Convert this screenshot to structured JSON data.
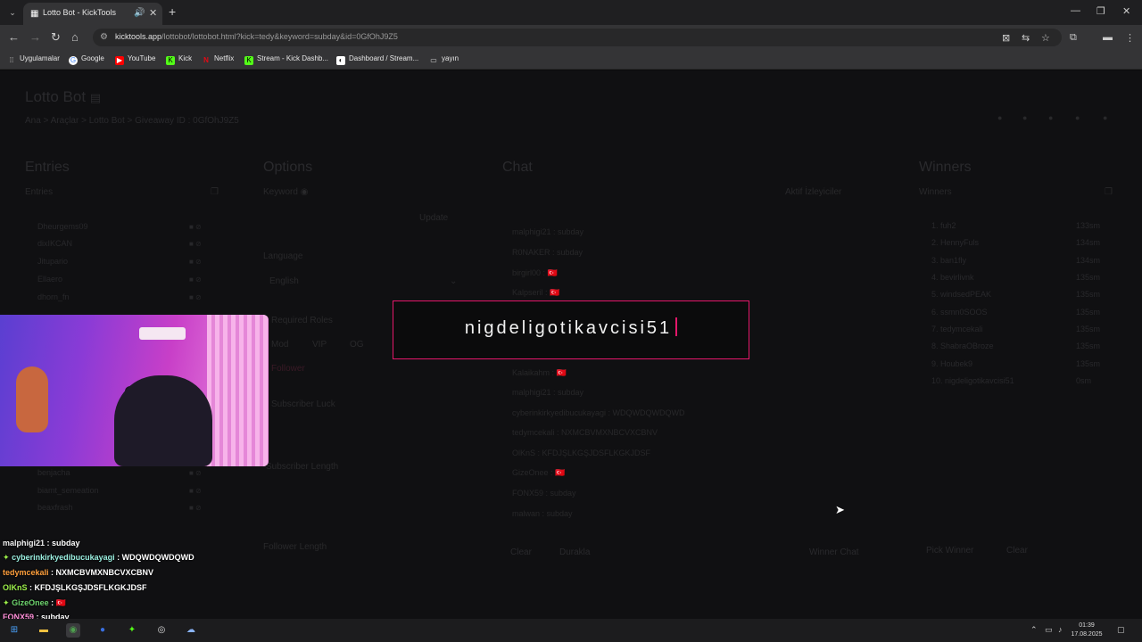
{
  "browser": {
    "tab_title": "Lotto Bot - KickTools",
    "url_host": "kicktools.app",
    "url_path": "/lottobot/lottobot.html?kick=tedy&keyword=subday&id=0GfOhJ9Z5",
    "bookmarks": [
      "Uygulamalar",
      "Google",
      "YouTube",
      "Kick",
      "Netflix",
      "Stream - Kick Dashb...",
      "Dashboard / Stream...",
      "yayın"
    ]
  },
  "page": {
    "title": "Lotto Bot",
    "breadcrumb": "Ana  >  Araçlar  >  Lotto Bot  >  Giveaway ID : 0GfOhJ9Z5",
    "columns": {
      "entries": "Entries",
      "options": "Options",
      "chat": "Chat",
      "winners": "Winners"
    },
    "entries_sub": "Entries",
    "entries": [
      "Dheurgems09",
      "dixIKCAN",
      "Jitupario",
      "Ellaero",
      "dhorn_fn",
      "benjacha",
      "biamt_semeation",
      "beaxfrash"
    ],
    "options": {
      "keyword_label": "Keyword",
      "update": "Update",
      "language_label": "Language",
      "language_value": "English",
      "required_roles": "Required Roles",
      "roles": [
        "Mod",
        "VIP",
        "OG"
      ],
      "follower": "Follower",
      "subscriber_luck": "Subscriber Luck",
      "subscriber_length": "Subscriber Length",
      "follower_length": "Follower Length"
    },
    "chat": {
      "subheader": "Aktif İzleyiciler",
      "lines": [
        "malphigi21 : subday",
        "R0NAKER : subday",
        "birgirl00 : 🇹🇷",
        "Kalpseril : 🇹🇷",
        "Kalaikahm : 🇹🇷",
        "malphigi21 : subday",
        "cyberinkirkyedibucukayagi : WDQWDQWDQWD",
        "tedymcekali : NXMCBVMXNBCVXCBNV",
        "OlKnS : KFDJŞLKGŞJDSFLKGKJDSF",
        "GizeOnee : 🇹🇷",
        "FONX59 : subday",
        "malwan : subday"
      ],
      "clear": "Clear",
      "pause": "Durakla",
      "winner_chat": "Winner Chat"
    },
    "winners_sub": "Winners",
    "winners": [
      {
        "rank": "1.",
        "name": "fuh2",
        "time": "133sm"
      },
      {
        "rank": "2.",
        "name": "HennyFuls",
        "time": "134sm"
      },
      {
        "rank": "3.",
        "name": "ban1fly",
        "time": "134sm"
      },
      {
        "rank": "4.",
        "name": "bevirlivnk",
        "time": "135sm"
      },
      {
        "rank": "5.",
        "name": "windsedPEAK",
        "time": "135sm"
      },
      {
        "rank": "6.",
        "name": "ssmn0SOOS",
        "time": "135sm"
      },
      {
        "rank": "7.",
        "name": "tedymcekali",
        "time": "135sm"
      },
      {
        "rank": "8.",
        "name": "ShabraOBroze",
        "time": "135sm"
      },
      {
        "rank": "9.",
        "name": "Houbek9",
        "time": "135sm"
      },
      {
        "rank": "10.",
        "name": "nigdeligotikavcisi51",
        "time": "0sm"
      }
    ],
    "pick_winner": "Pick Winner",
    "clear_winners": "Clear"
  },
  "modal": {
    "winner_name": "nigdeligotikavcisi51"
  },
  "overlay_chat": [
    {
      "user": "malphigi21",
      "msg": ": subday",
      "cls": "u1",
      "badge": ""
    },
    {
      "user": "cyberinkirkyedibucukayagi",
      "msg": ": WDQWDQWDQWD",
      "cls": "u2",
      "badge": "✦"
    },
    {
      "user": "tedymcekali",
      "msg": ": NXMCBVMXNBCVXCBNV",
      "cls": "u3",
      "badge": ""
    },
    {
      "user": "OlKnS",
      "msg": ": KFDJŞLKGŞJDSFLKGKJDSF",
      "cls": "u4",
      "badge": ""
    },
    {
      "user": "GizeOnee",
      "msg": ": 🇹🇷",
      "cls": "u5",
      "badge": "✦"
    },
    {
      "user": "FONX59",
      "msg": ": subday",
      "cls": "u6",
      "badge": ""
    }
  ],
  "clock": {
    "time": "01:39",
    "date": "17.08.2025"
  },
  "colors": {
    "accent": "#e4176a",
    "bg": "#0b0b0c"
  }
}
